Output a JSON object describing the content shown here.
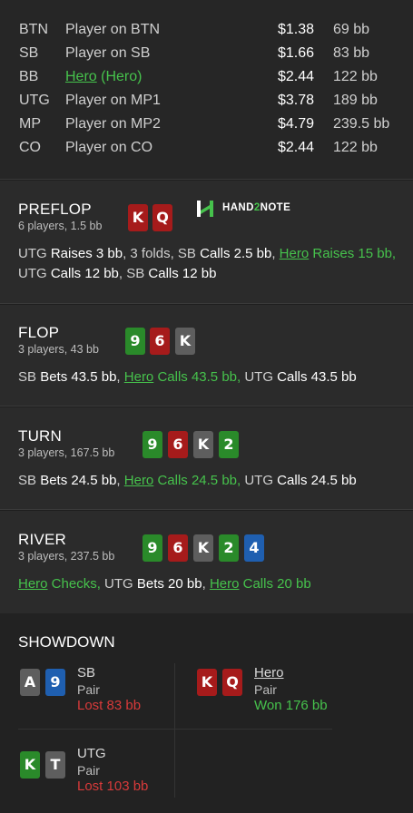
{
  "players": [
    {
      "pos": "BTN",
      "name": "Player on BTN",
      "amount": "$1.38",
      "bb": "69 bb"
    },
    {
      "pos": "SB",
      "name": "Player on SB",
      "amount": "$1.66",
      "bb": "83 bb"
    },
    {
      "pos": "BB",
      "name": "Hero",
      "name_suffix": " (Hero)",
      "amount": "$2.44",
      "bb": "122 bb"
    },
    {
      "pos": "UTG",
      "name": "Player on MP1",
      "amount": "$3.78",
      "bb": "189 bb"
    },
    {
      "pos": "MP",
      "name": "Player on MP2",
      "amount": "$4.79",
      "bb": "239.5 bb"
    },
    {
      "pos": "CO",
      "name": "Player on CO",
      "amount": "$2.44",
      "bb": "122 bb"
    }
  ],
  "logo": {
    "text_a": "HAND",
    "text_b": "2",
    "text_c": "NOTE",
    "icon": "h2n-logo-icon"
  },
  "preflop": {
    "title": "PREFLOP",
    "sub": "6 players, 1.5 bb",
    "cards": [
      {
        "rank": "K",
        "color": "#a61b1b"
      },
      {
        "rank": "Q",
        "color": "#a61b1b"
      }
    ],
    "a1": "UTG ",
    "a2": "Raises 3 bb",
    ",": "",
    "a3": ", 3 folds, SB ",
    "a4": "Calls 2.5 bb",
    "a5": ", ",
    "a6": "Hero",
    "a7": " Raises 15 bb,",
    "a8": " UTG ",
    "a9": "Calls 12 bb",
    "a10": ", SB ",
    "a11": "Calls 12 bb"
  },
  "flop": {
    "title": "FLOP",
    "sub": "3 players, 43 bb",
    "cards": [
      {
        "rank": "9"
      },
      {
        "rank": "6"
      },
      {
        "rank": "K"
      }
    ],
    "a1": "SB ",
    "a2": "Bets 43.5 bb",
    "a3": ", ",
    "a4": "Hero",
    "a5": " Calls 43.5 bb,",
    "a6": " UTG ",
    "a7": "Calls 43.5 bb"
  },
  "turn": {
    "title": "TURN",
    "sub": "3 players, 167.5 bb",
    "cards": [
      {
        "rank": "9"
      },
      {
        "rank": "6"
      },
      {
        "rank": "K"
      },
      {
        "rank": "2"
      }
    ],
    "a1": "SB ",
    "a2": "Bets 24.5 bb",
    "a3": ", ",
    "a4": "Hero",
    "a5": " Calls 24.5 bb,",
    "a6": " UTG ",
    "a7": "Calls 24.5 bb"
  },
  "river": {
    "title": "RIVER",
    "sub": "3 players, 237.5 bb",
    "cards": [
      {
        "rank": "9"
      },
      {
        "rank": "6"
      },
      {
        "rank": "K"
      },
      {
        "rank": "2"
      },
      {
        "rank": "4"
      }
    ],
    "a1": "Hero",
    "a2": " Checks,",
    "a3": " UTG ",
    "a4": "Bets 20 bb",
    "a5": ", ",
    "a6": "Hero",
    "a7": " Calls 20 bb"
  },
  "showdown": {
    "title": "SHOWDOWN",
    "sb": {
      "cards": [
        {
          "rank": "A"
        },
        {
          "rank": "9"
        }
      ],
      "name": "SB",
      "hand": "Pair",
      "result": "Lost 83 bb"
    },
    "hero": {
      "cards": [
        {
          "rank": "K"
        },
        {
          "rank": "Q"
        }
      ],
      "name": "Hero",
      "hand": "Pair",
      "result": "Won 176 bb"
    },
    "utg": {
      "cards": [
        {
          "rank": "K"
        },
        {
          "rank": "T"
        }
      ],
      "name": "UTG",
      "hand": "Pair",
      "result": "Lost 103 bb"
    }
  },
  "colors": {
    "green": "#46c24c",
    "red": "#d83a3a",
    "card_red": "#a61b1b",
    "card_green": "#2a8a2a",
    "card_gray": "#5e5e5e",
    "card_blue": "#1f5fb0"
  }
}
